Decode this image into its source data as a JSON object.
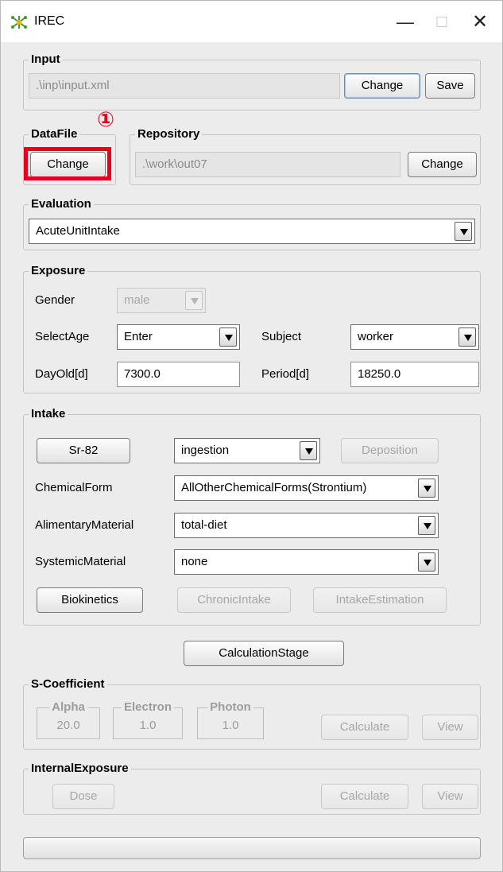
{
  "window": {
    "title": "IREC",
    "minimize": "—",
    "maximize": "☐",
    "close": "✕"
  },
  "input": {
    "legend": "Input",
    "path": ".\\inp\\input.xml",
    "change_label": "Change",
    "save_label": "Save"
  },
  "datafile": {
    "legend": "DataFile",
    "change_label": "Change",
    "marker": "①"
  },
  "repository": {
    "legend": "Repository",
    "path": ".\\work\\out07",
    "change_label": "Change"
  },
  "evaluation": {
    "legend": "Evaluation",
    "selected": "AcuteUnitIntake"
  },
  "exposure": {
    "legend": "Exposure",
    "gender_label": "Gender",
    "gender_value": "male",
    "selectage_label": "SelectAge",
    "selectage_value": "Enter",
    "subject_label": "Subject",
    "subject_value": "worker",
    "dayold_label": "DayOld[d]",
    "dayold_value": "7300.0",
    "period_label": "Period[d]",
    "period_value": "18250.0"
  },
  "intake": {
    "legend": "Intake",
    "nuclide_button": "Sr-82",
    "route_value": "ingestion",
    "deposition_button": "Deposition",
    "chemicalform_label": "ChemicalForm",
    "chemicalform_value": "AllOtherChemicalForms(Strontium)",
    "alimentary_label": "AlimentaryMaterial",
    "alimentary_value": "total-diet",
    "systemic_label": "SystemicMaterial",
    "systemic_value": "none",
    "biokinetics_button": "Biokinetics",
    "chronic_button": "ChronicIntake",
    "estimation_button": "IntakeEstimation"
  },
  "calculation_stage": {
    "label": "CalculationStage"
  },
  "s_coefficient": {
    "legend": "S-Coefficient",
    "alpha_label": "Alpha",
    "alpha_value": "20.0",
    "electron_label": "Electron",
    "electron_value": "1.0",
    "photon_label": "Photon",
    "photon_value": "1.0",
    "calculate_button": "Calculate",
    "view_button": "View"
  },
  "internal_exposure": {
    "legend": "InternalExposure",
    "dose_button": "Dose",
    "calculate_button": "Calculate",
    "view_button": "View"
  },
  "colors": {
    "highlight": "#e8001c",
    "window_bg": "#ececec"
  }
}
